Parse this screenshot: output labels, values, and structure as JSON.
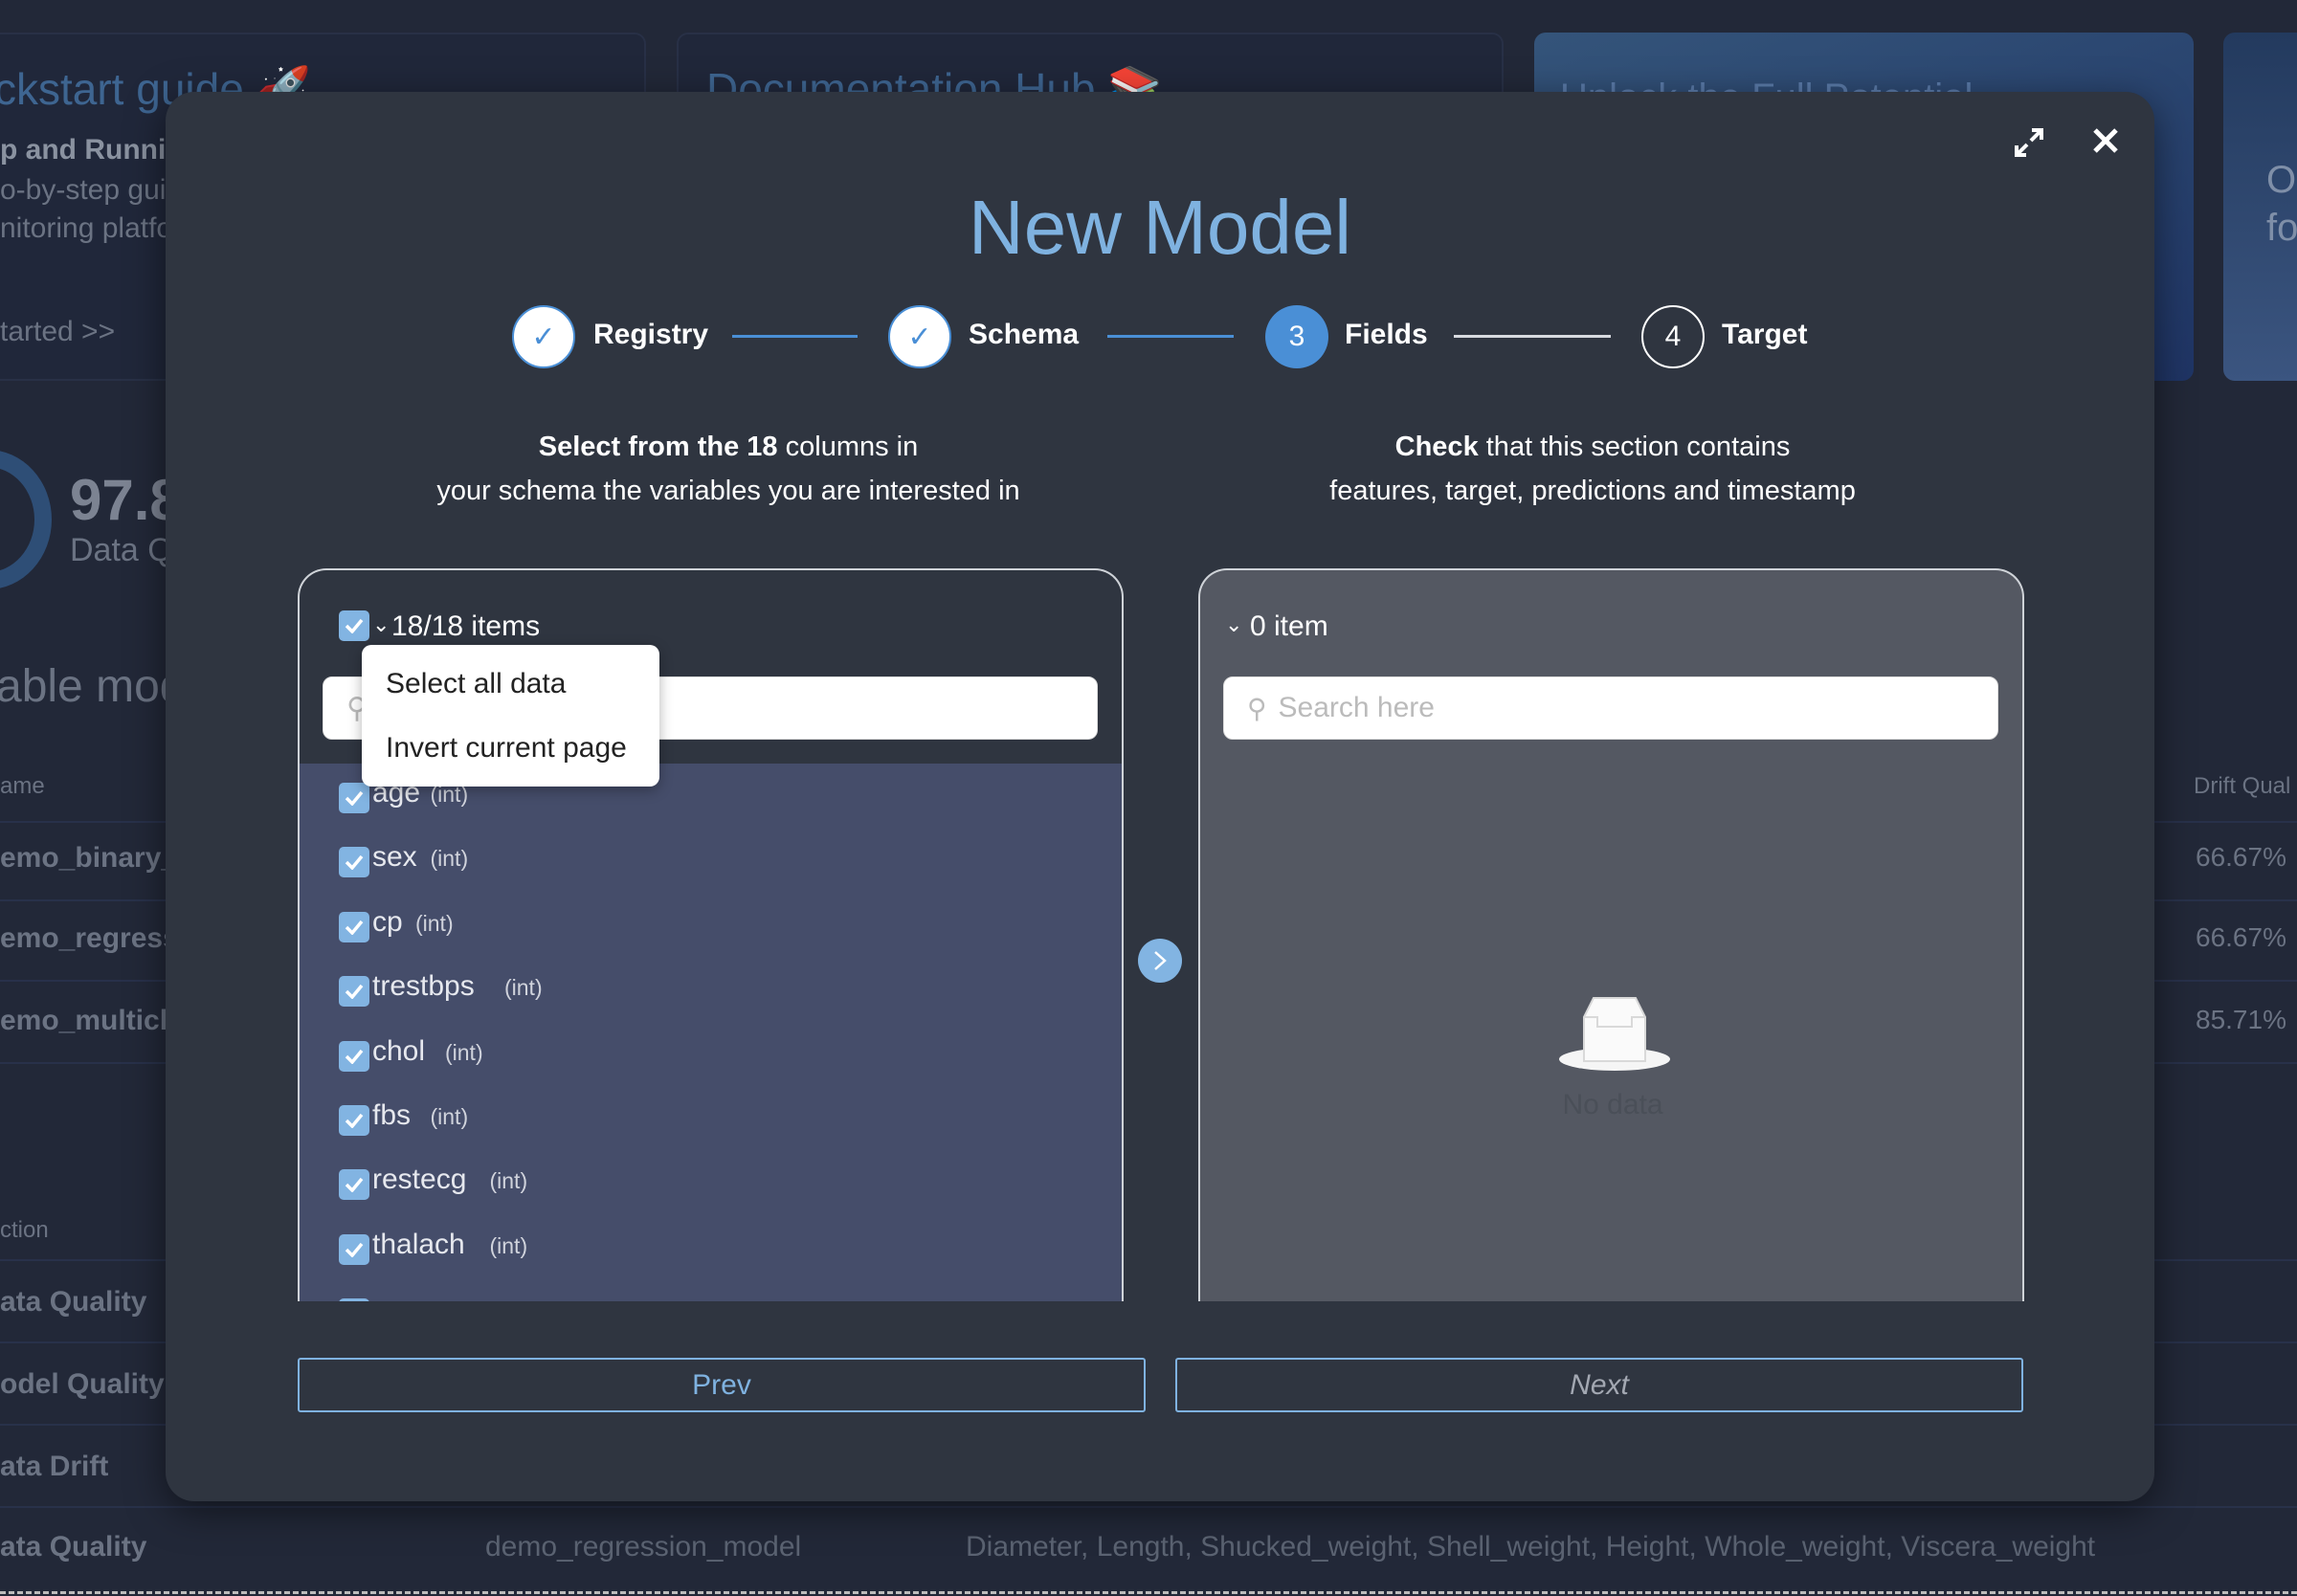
{
  "background": {
    "cards": [
      {
        "title": "ckstart guide 🚀",
        "subtitle": "p and Runni",
        "lines": [
          "o-by-step guid",
          "nitoring platfo"
        ],
        "link": "tarted >>"
      },
      {
        "title": "Documentation Hub 📚"
      },
      {
        "title": "Unlock the Full Potential"
      },
      {
        "lines": [
          "O",
          "fo"
        ]
      }
    ],
    "metric": {
      "value": "97.8",
      "label": "Data Q"
    },
    "models_title": "able mode",
    "models_table": {
      "headers": [
        "ame",
        "Drift Qual"
      ],
      "rows": [
        {
          "name": "emo_binary_r",
          "drift": "66.67%"
        },
        {
          "name": "emo_regressi",
          "drift": "66.67%"
        },
        {
          "name": "emo_multicla",
          "drift": "85.71%"
        }
      ]
    },
    "alerts_table": {
      "header": "ction",
      "rows": [
        {
          "section": "ata Quality"
        },
        {
          "section": "odel Quality"
        },
        {
          "section": "ata Drift"
        },
        {
          "section": "ata Quality",
          "model": "demo_regression_model",
          "features": "Diameter, Length, Shucked_weight, Shell_weight, Height, Whole_weight, Viscera_weight"
        }
      ]
    }
  },
  "modal": {
    "title": "New Model",
    "steps": [
      {
        "label": "Registry",
        "status": "done"
      },
      {
        "label": "Schema",
        "status": "done"
      },
      {
        "number": "3",
        "label": "Fields",
        "status": "current"
      },
      {
        "number": "4",
        "label": "Target",
        "status": "pending"
      }
    ],
    "left_desc": {
      "bold": "Select from the 18",
      "rest": " columns in",
      "line2": "your schema the variables you are interested in"
    },
    "right_desc": {
      "bold": "Check",
      "rest": " that this section contains",
      "line2": "features, target, predictions and timestamp"
    },
    "source": {
      "count_label": "18/18 items",
      "search_placeholder": "Search here",
      "dropdown": [
        "Select all data",
        "Invert current page"
      ],
      "items": [
        {
          "name": "age",
          "type": "(int)"
        },
        {
          "name": "sex",
          "type": "(int)"
        },
        {
          "name": "cp",
          "type": "(int)"
        },
        {
          "name": "trestbps",
          "type": "(int)"
        },
        {
          "name": "chol",
          "type": "(int)"
        },
        {
          "name": "fbs",
          "type": "(int)"
        },
        {
          "name": "restecg",
          "type": "(int)"
        },
        {
          "name": "thalach",
          "type": "(int)"
        }
      ]
    },
    "target": {
      "count_label": "0 item",
      "search_placeholder": "Search here",
      "empty_text": "No data"
    },
    "prev_label": "Prev",
    "next_label": "Next"
  },
  "colors": {
    "accent": "#7fb2e0",
    "step_active": "#4a8fd6",
    "background": "#222838",
    "modal": "#2f3540",
    "list_bg": "#454d6a",
    "target_bg": "#545862"
  }
}
